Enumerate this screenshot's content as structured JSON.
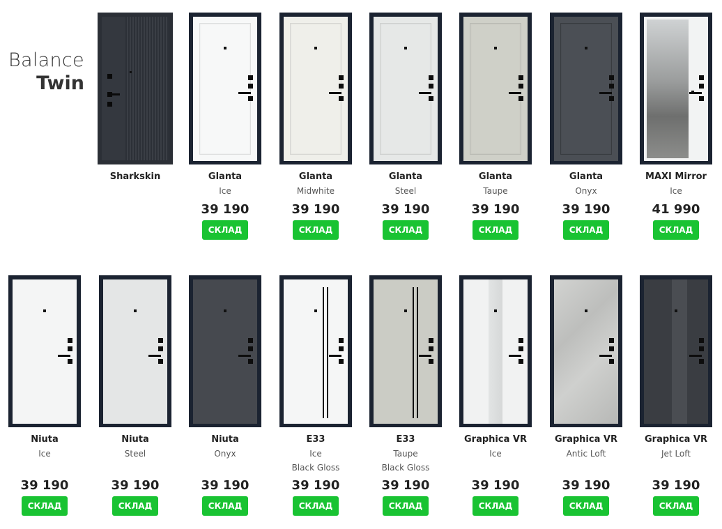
{
  "brand": {
    "line1": "Balance",
    "line2": "Twin"
  },
  "sharkskin": {
    "name": "Sharkskin"
  },
  "stock_label": "СКЛАД",
  "colors": {
    "frame": "#1b2331",
    "accent_green": "#19c332"
  },
  "row1": [
    {
      "name": "Glanta",
      "finish": "Ice",
      "finish2": "",
      "price": "39 190",
      "leaf": "#f7f8f8",
      "style": "panel"
    },
    {
      "name": "Glanta",
      "finish": "Midwhite",
      "finish2": "",
      "price": "39 190",
      "leaf": "#efefea",
      "style": "panel"
    },
    {
      "name": "Glanta",
      "finish": "Steel",
      "finish2": "",
      "price": "39 190",
      "leaf": "#e6e8e7",
      "style": "panel"
    },
    {
      "name": "Glanta",
      "finish": "Taupe",
      "finish2": "",
      "price": "39 190",
      "leaf": "#cfd0c8",
      "style": "panel"
    },
    {
      "name": "Glanta",
      "finish": "Onyx",
      "finish2": "",
      "price": "39 190",
      "leaf": "#4b4f55",
      "style": "panel"
    },
    {
      "name": "MAXI Mirror",
      "finish": "Ice",
      "finish2": "",
      "price": "41 990",
      "leaf": "#f2f3f3",
      "style": "mirror"
    }
  ],
  "row2": [
    {
      "name": "Niuta",
      "finish": "Ice",
      "finish2": "",
      "price": "39 190",
      "leaf": "#f4f5f5",
      "style": "flat"
    },
    {
      "name": "Niuta",
      "finish": "Steel",
      "finish2": "",
      "price": "39 190",
      "leaf": "#e4e6e6",
      "style": "flat"
    },
    {
      "name": "Niuta",
      "finish": "Onyx",
      "finish2": "",
      "price": "39 190",
      "leaf": "#46494f",
      "style": "flat"
    },
    {
      "name": "E33",
      "finish": "Ice",
      "finish2": "Black Gloss",
      "price": "39 190",
      "leaf": "#f5f6f6",
      "style": "lines"
    },
    {
      "name": "E33",
      "finish": "Taupe",
      "finish2": "Black Gloss",
      "price": "39 190",
      "leaf": "#cbccc5",
      "style": "lines"
    },
    {
      "name": "Graphica VR",
      "finish": "Ice",
      "finish2": "",
      "price": "39 190",
      "leaf": "#f1f2f2",
      "style": "graph-ice"
    },
    {
      "name": "Graphica VR",
      "finish": "Antic Loft",
      "finish2": "",
      "price": "39 190",
      "leaf": "#c9cac8",
      "style": "graph-loft"
    },
    {
      "name": "Graphica VR",
      "finish": "Jet Loft",
      "finish2": "",
      "price": "39 190",
      "leaf": "#3a3d42",
      "style": "graph-jet"
    }
  ]
}
